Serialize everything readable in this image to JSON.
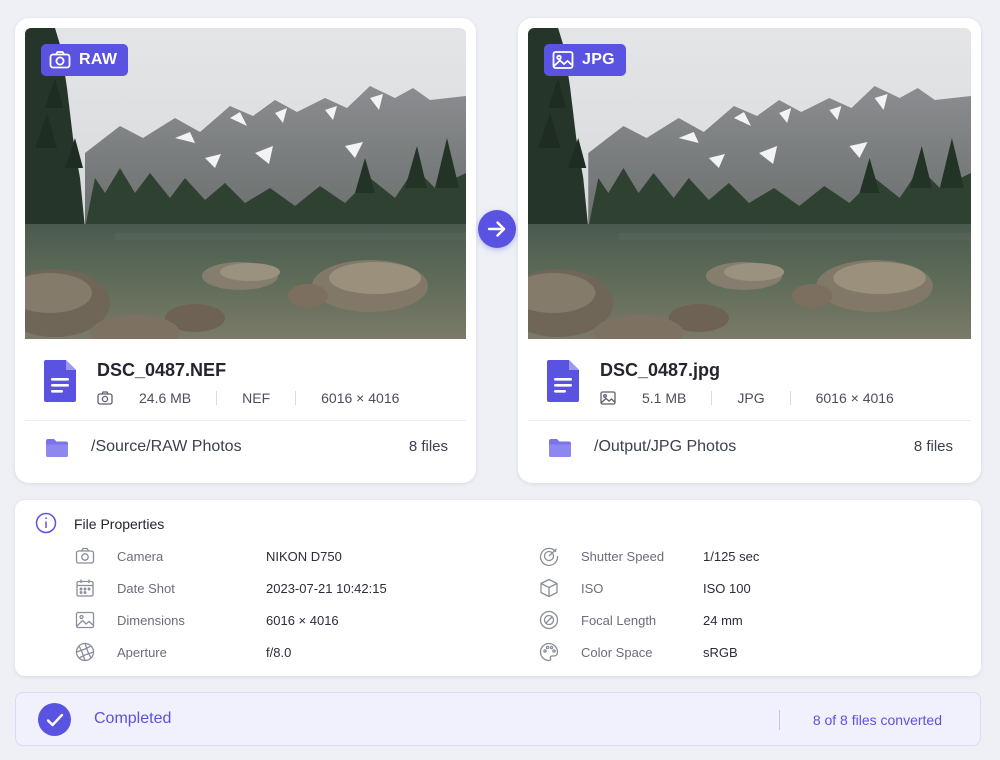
{
  "source": {
    "badge_label": "RAW",
    "file_name": "DSC_0487.NEF",
    "size": "24.6 MB",
    "format": "NEF",
    "dimensions": "6016 × 4016",
    "folder_path": "/Source/RAW Photos",
    "folder_count": "8 files"
  },
  "output": {
    "badge_label": "JPG",
    "file_name": "DSC_0487.jpg",
    "size": "5.1 MB",
    "format": "JPG",
    "dimensions": "6016 × 4016",
    "folder_path": "/Output/JPG Photos",
    "folder_count": "8 files"
  },
  "properties": {
    "title": "File Properties",
    "left": [
      {
        "icon": "camera-icon",
        "label": "Camera",
        "value": "NIKON D750"
      },
      {
        "icon": "calendar-icon",
        "label": "Date Shot",
        "value": "2023-07-21 10:42:15"
      },
      {
        "icon": "image-icon",
        "label": "Dimensions",
        "value": "6016 × 4016"
      },
      {
        "icon": "aperture-icon",
        "label": "Aperture",
        "value": "f/8.0"
      }
    ],
    "right": [
      {
        "icon": "shutter-icon",
        "label": "Shutter Speed",
        "value": "1/125 sec"
      },
      {
        "icon": "iso-cube-icon",
        "label": "ISO",
        "value": "ISO 100"
      },
      {
        "icon": "focal-length-icon",
        "label": "Focal Length",
        "value": "24 mm"
      },
      {
        "icon": "palette-icon",
        "label": "Color Space",
        "value": "sRGB"
      }
    ]
  },
  "status": {
    "label": "Completed",
    "count": "8 of 8 files converted"
  },
  "colors": {
    "accent": "#5a52e0",
    "background": "#eef0f6",
    "status_bg": "#f1f0fd"
  }
}
